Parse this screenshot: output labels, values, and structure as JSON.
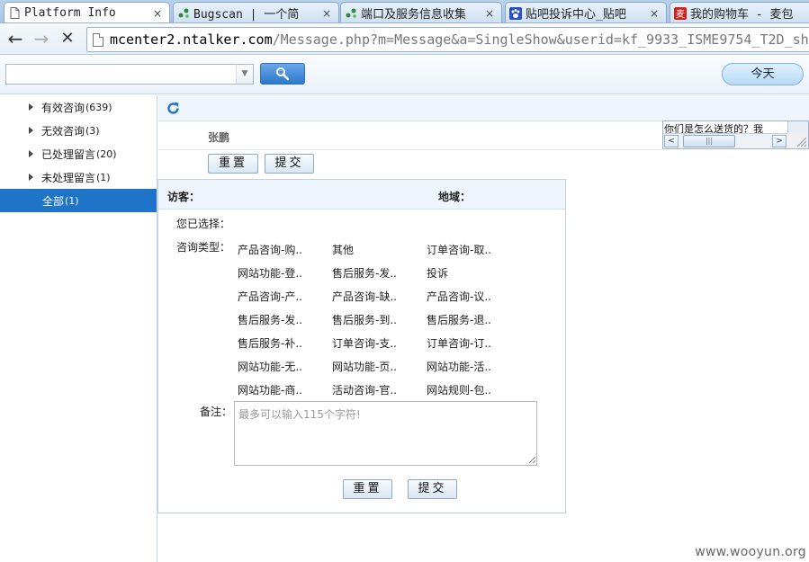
{
  "browser": {
    "tabs": [
      {
        "title": "Platform Info",
        "icon": "page-icon",
        "active": true
      },
      {
        "title": "Bugscan | 一个简",
        "icon": "bugscan-icon",
        "active": false
      },
      {
        "title": "端口及服务信息收集",
        "icon": "bugscan-icon",
        "active": false
      },
      {
        "title": "贴吧投诉中心_贴吧",
        "icon": "baidu-paw-icon",
        "active": false
      },
      {
        "title": "我的购物车 - 麦包",
        "icon": "mai-icon",
        "active": false
      }
    ],
    "close_glyph": "×",
    "url_host": "mcenter2.ntalker.com",
    "url_path": "/Message.php?m=Message&a=SingleShow&userid=kf_9933_ISME9754_T2D_she",
    "nav": {
      "back": "←",
      "forward": "→",
      "stop": "✕"
    }
  },
  "appbar": {
    "search_value": "",
    "dropdown_glyph": "▼",
    "today_label": "今天"
  },
  "sidebar": {
    "items": [
      {
        "label": "有效咨询",
        "count": "(639)",
        "active": false
      },
      {
        "label": "无效咨询",
        "count": "(3)",
        "active": false
      },
      {
        "label": "已处理留言",
        "count": "(20)",
        "active": false
      },
      {
        "label": "未处理留言",
        "count": "(1)",
        "active": false
      },
      {
        "label": "全部",
        "count": "(1)",
        "active": true
      }
    ]
  },
  "content": {
    "visitor_name": "张鹏",
    "mini_pane_text": "你们是怎么送货的？我",
    "mini_thumb_glyph": "|||",
    "mini_left": "<",
    "mini_right": ">",
    "top_reset": "重置",
    "top_submit": "提交"
  },
  "panel": {
    "visitor_label": "访客：",
    "region_label": "地域：",
    "selected_label": "您已选择：",
    "type_label": "咨询类型：",
    "options": [
      [
        "产品咨询-购..",
        "其他",
        "订单咨询-取.."
      ],
      [
        "网站功能-登..",
        "售后服务-发..",
        "投诉"
      ],
      [
        "产品咨询-产..",
        "产品咨询-缺..",
        "产品咨询-议.."
      ],
      [
        "售后服务-发..",
        "售后服务-到..",
        "售后服务-退.."
      ],
      [
        "售后服务-补..",
        "订单咨询-支..",
        "订单咨询-订.."
      ],
      [
        "网站功能-无..",
        "网站功能-页..",
        "网站功能-活.."
      ],
      [
        "网站功能-商..",
        "活动咨询-官..",
        "网站规则-包.."
      ]
    ],
    "remark_label": "备注：",
    "remark_placeholder": "最多可以输入115个字符!",
    "reset_label": "重置",
    "submit_label": "提交"
  },
  "watermark": "www.wooyun.org"
}
